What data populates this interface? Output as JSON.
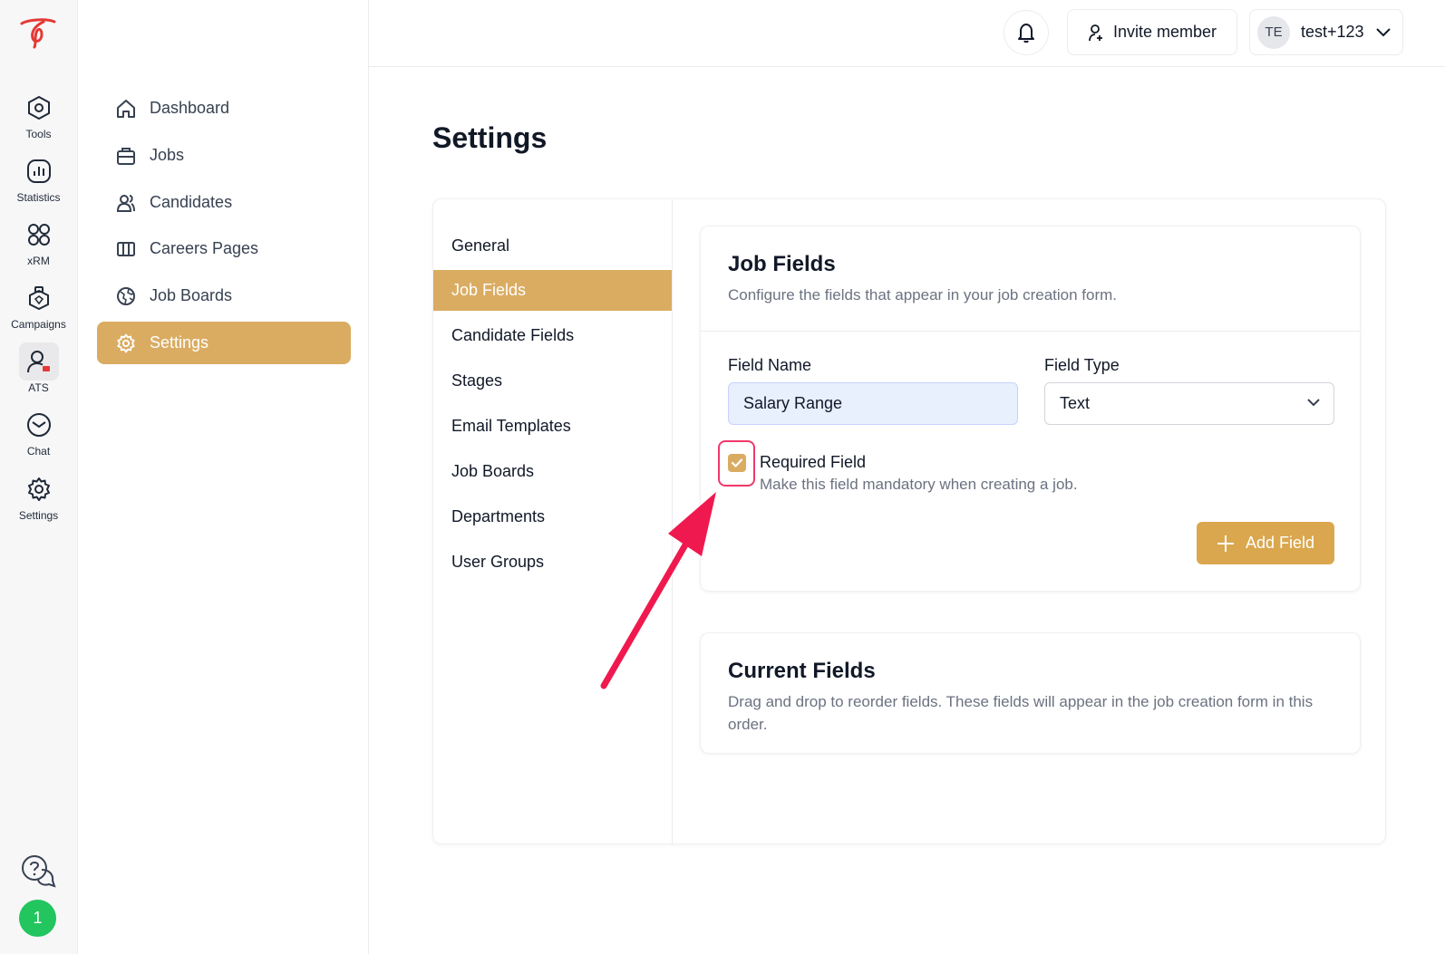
{
  "rail": {
    "items": [
      {
        "label": "Tools"
      },
      {
        "label": "Statistics"
      },
      {
        "label": "xRM"
      },
      {
        "label": "Campaigns"
      },
      {
        "label": "ATS"
      },
      {
        "label": "Chat"
      },
      {
        "label": "Settings"
      }
    ],
    "badge": "1"
  },
  "sidenav": {
    "items": [
      {
        "label": "Dashboard"
      },
      {
        "label": "Jobs"
      },
      {
        "label": "Candidates"
      },
      {
        "label": "Careers Pages"
      },
      {
        "label": "Job Boards"
      },
      {
        "label": "Settings"
      }
    ]
  },
  "topbar": {
    "invite_label": "Invite member",
    "avatar_initials": "TE",
    "username": "test+123"
  },
  "page": {
    "title": "Settings"
  },
  "settings_menu": {
    "items": [
      {
        "label": "General"
      },
      {
        "label": "Job Fields"
      },
      {
        "label": "Candidate Fields"
      },
      {
        "label": "Stages"
      },
      {
        "label": "Email Templates"
      },
      {
        "label": "Job Boards"
      },
      {
        "label": "Departments"
      },
      {
        "label": "User Groups"
      }
    ]
  },
  "job_fields": {
    "title": "Job Fields",
    "description": "Configure the fields that appear in your job creation form.",
    "field_name_label": "Field Name",
    "field_name_value": "Salary Range",
    "field_type_label": "Field Type",
    "field_type_value": "Text",
    "required_title": "Required Field",
    "required_desc": "Make this field mandatory when creating a job.",
    "add_button": "Add Field"
  },
  "current_fields": {
    "title": "Current Fields",
    "description": "Drag and drop to reorder fields. These fields will appear in the job creation form in this order."
  },
  "colors": {
    "accent": "#daac62",
    "annotation": "#f0194f"
  }
}
